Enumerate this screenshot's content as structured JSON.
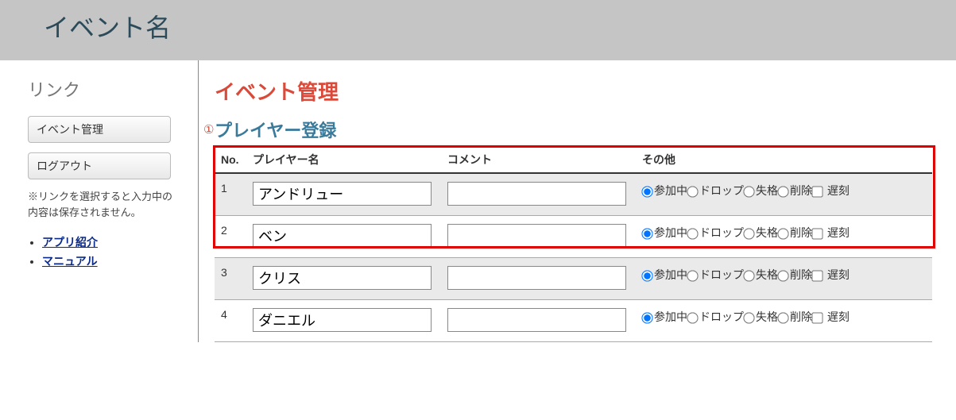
{
  "header": {
    "title": "イベント名"
  },
  "sidebar": {
    "heading": "リンク",
    "buttons": {
      "event_mgmt": "イベント管理",
      "logout": "ログアウト"
    },
    "note": "※リンクを選択すると入力中の内容は保存されません。",
    "links": {
      "app_intro": "アプリ紹介",
      "manual": "マニュアル"
    }
  },
  "main": {
    "page_title": "イベント管理",
    "section_title": "プレイヤー登録",
    "marker": "①",
    "columns": {
      "no": "No.",
      "name": "プレイヤー名",
      "comment": "コメント",
      "other": "その他"
    },
    "status_labels": {
      "active": "参加中",
      "drop": "ドロップ",
      "dq": "失格",
      "delete": "削除",
      "late": "遅刻"
    },
    "rows": [
      {
        "no": "1",
        "name": "アンドリュー",
        "comment": "",
        "status": "active",
        "late": false
      },
      {
        "no": "2",
        "name": "ベン",
        "comment": "",
        "status": "active",
        "late": false
      },
      {
        "no": "3",
        "name": "クリス",
        "comment": "",
        "status": "active",
        "late": false
      },
      {
        "no": "4",
        "name": "ダニエル",
        "comment": "",
        "status": "active",
        "late": false
      }
    ]
  }
}
